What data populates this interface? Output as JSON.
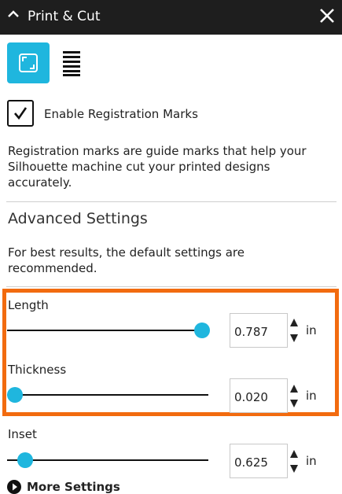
{
  "titlebar": {
    "title": "Print & Cut"
  },
  "registration": {
    "checkbox_label": "Enable Registration Marks",
    "description": "Registration marks are guide marks that help your Silhouette machine cut your printed designs accurately."
  },
  "advanced": {
    "title": "Advanced Settings",
    "description": "For best results, the default settings are recommended."
  },
  "settings": {
    "length": {
      "label": "Length",
      "value": "0.787",
      "unit": "in",
      "slider_fraction": 0.97
    },
    "thickness": {
      "label": "Thickness",
      "value": "0.020",
      "unit": "in",
      "slider_fraction": 0.04
    },
    "inset": {
      "label": "Inset",
      "value": "0.625",
      "unit": "in",
      "slider_fraction": 0.09
    }
  },
  "more_settings": {
    "label": "More Settings"
  },
  "colors": {
    "accent": "#1fb6de",
    "highlight": "#f26b0f",
    "titlebar": "#1e1e1e"
  },
  "icons": [
    "chevron-up-icon",
    "close-icon",
    "registration-marks-icon",
    "list-icon",
    "checkmark-icon",
    "spinner-up-icon",
    "spinner-down-icon",
    "play-circle-icon"
  ]
}
